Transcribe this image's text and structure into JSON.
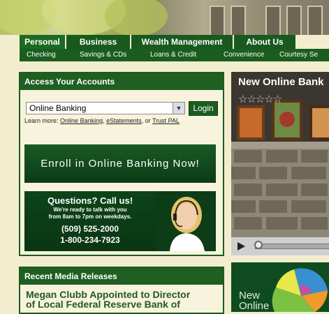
{
  "nav": {
    "tabs": [
      "Personal",
      "Business",
      "Wealth Management",
      "About Us"
    ],
    "subnav": [
      "Checking",
      "Savings & CDs",
      "Loans & Credit",
      "Convenience",
      "Courtesy Se"
    ]
  },
  "access": {
    "title": "Access Your Accounts",
    "select_value": "Online Banking",
    "login_label": "Login",
    "learn_prefix": "Learn more:",
    "link_online": "Online Banking",
    "sep1": ",",
    "link_estatements": "eStatements",
    "sep2": ", or",
    "link_trustpal": "Trust PAL"
  },
  "enroll": {
    "label": "Enroll in Online Banking Now!"
  },
  "questions": {
    "title": "Questions? Call us!",
    "line1": "We're ready to talk with you",
    "line2": "from 8am to 7pm on weekdays.",
    "phone1": "(509) 525-2000",
    "phone2": "1-800-234-7923"
  },
  "video": {
    "title": "New Online Bank",
    "rating_stars": 5
  },
  "media": {
    "title": "Recent Media Releases",
    "headline_line1": "Megan Clubb Appointed to Director",
    "headline_line2": "of Local Federal Reserve Bank of"
  },
  "promo": {
    "line1": "New",
    "line2": "Online"
  },
  "colors": {
    "brand_green": "#1a5d1f",
    "page_bg": "#f3edcf"
  }
}
